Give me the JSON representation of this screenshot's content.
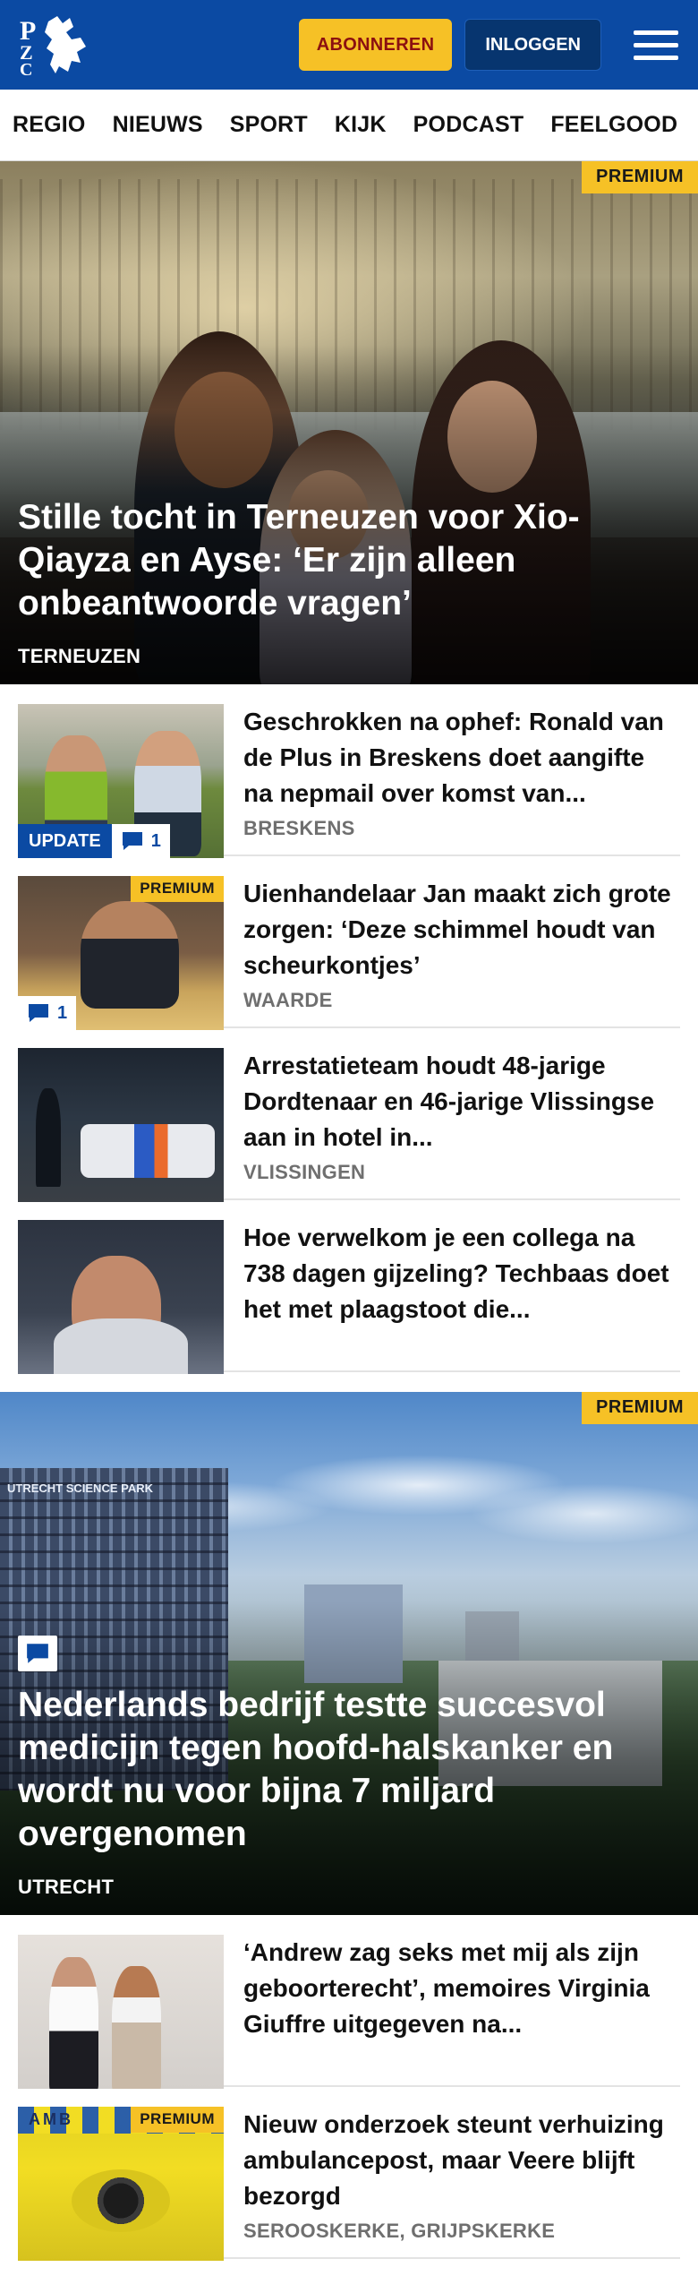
{
  "header": {
    "logo_text": "PZC",
    "subscribe_label": "ABONNEREN",
    "login_label": "INLOGGEN"
  },
  "nav": {
    "items": [
      "REGIO",
      "NIEUWS",
      "SPORT",
      "KIJK",
      "PODCAST",
      "FEELGOOD"
    ]
  },
  "hero1": {
    "badge": "PREMIUM",
    "title": "Stille tocht in Terneuzen voor Xio-Qiayza en Ayse: ‘Er zijn alleen onbeantwoorde vragen’",
    "location": "TERNEUZEN"
  },
  "list1": [
    {
      "title": "Geschrokken na ophef: Ronald van de Plus in Breskens doet aangifte na nepmail over komst van...",
      "location": "BRESKENS",
      "tag": "UPDATE",
      "comments": "1"
    },
    {
      "title": "Uienhandelaar Jan maakt zich grote zorgen: ‘Deze schimmel houdt van scheurkontjes’",
      "location": "WAARDE",
      "badge": "PREMIUM",
      "comments": "1"
    },
    {
      "title": "Arrestatieteam houdt 48-jarige Dordtenaar en 46-jarige Vlissingse aan in hotel in...",
      "location": "VLISSINGEN"
    },
    {
      "title": "Hoe verwelkom je een collega na 738 dagen gijzeling? Techbaas doet het met plaagstoot die...",
      "location": ""
    }
  ],
  "hero2": {
    "badge": "PREMIUM",
    "building_sign": "UTRECHT SCIENCE PARK",
    "title": "Nederlands bedrijf testte succesvol medicijn tegen hoofd-halskanker en wordt nu voor bijna 7 miljard overgenomen",
    "location": "UTRECHT"
  },
  "list2": [
    {
      "title": "‘Andrew zag seks met mij als zijn geboorterecht’, memoires Virginia Giuffre uitgegeven na...",
      "location": ""
    },
    {
      "title": "Nieuw onderzoek steunt verhuizing ambulancepost, maar Veere blijft bezorgd",
      "location": "SEROOSKERKE, GRIJPSKERKE",
      "badge": "PREMIUM",
      "image_text": "AMB"
    }
  ],
  "colors": {
    "brand_blue": "#0b4aa3",
    "premium_yellow": "#f6c126",
    "subscribe_text": "#8b1010"
  }
}
